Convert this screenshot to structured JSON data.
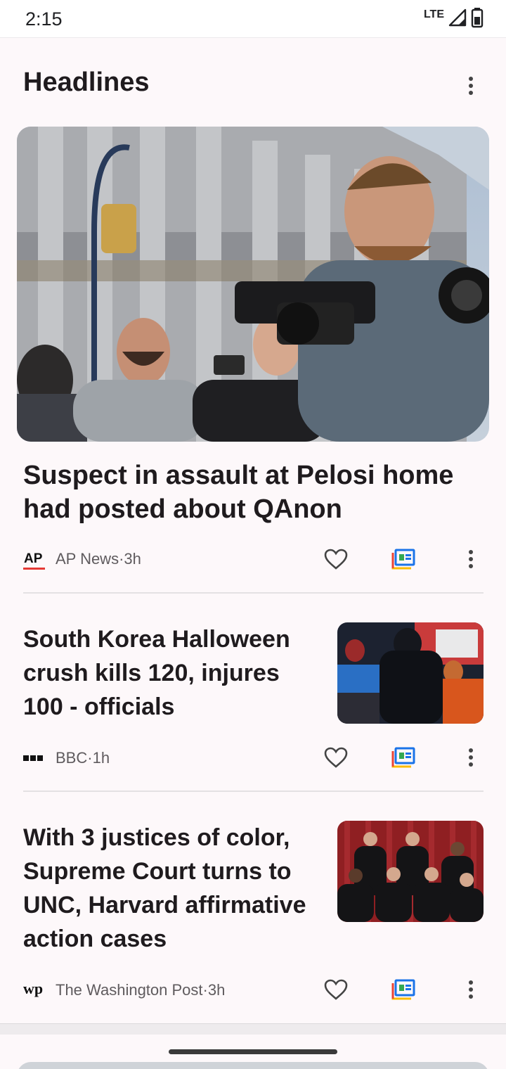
{
  "status_bar": {
    "time": "2:15",
    "network": "LTE"
  },
  "header": {
    "title": "Headlines"
  },
  "articles": [
    {
      "title": "Suspect in assault at Pelosi home had posted about QAnon",
      "source_logo": "AP",
      "source": "AP News",
      "separator": " · ",
      "age": "3h"
    },
    {
      "title": "South Korea Halloween crush kills 120, injures 100 - officials",
      "source_logo": "BBC",
      "source": "BBC",
      "separator": " · ",
      "age": "1h"
    },
    {
      "title": "With 3 justices of color, Supreme Court turns to UNC, Harvard affirmative action cases",
      "source_logo": "wp",
      "source": "The Washington Post",
      "separator": " · ",
      "age": "3h"
    }
  ],
  "colors": {
    "background": "#fdf8fa",
    "text": "#1f1b1e",
    "meta_text": "#5f5b5e",
    "google_blue": "#1a73e8",
    "google_red": "#ea4335",
    "google_yellow": "#fbbc04",
    "google_green": "#34a853"
  }
}
